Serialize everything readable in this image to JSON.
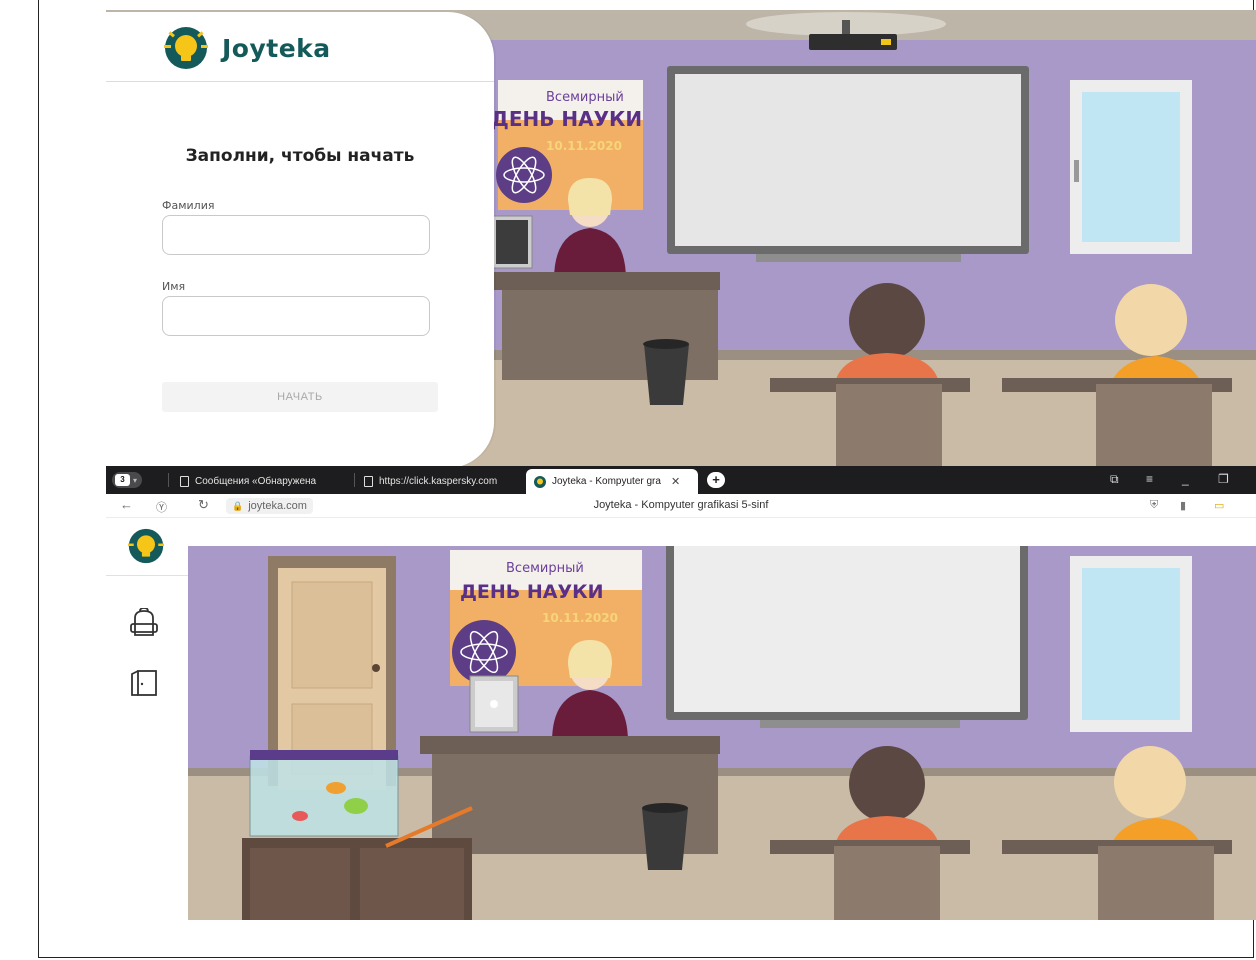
{
  "login": {
    "brand_name": "Joyteka",
    "form_title": "Заполни, чтобы начать",
    "surname_label": "Фамилия",
    "surname_value": "",
    "name_label": "Имя",
    "name_value": "",
    "start_button": "НАЧАТЬ"
  },
  "browser": {
    "tab_count": "3",
    "tabs": [
      {
        "label": "Сообщения «Обнаружена"
      },
      {
        "label": "https://click.kaspersky.com"
      },
      {
        "label": "Joyteka - Kompyuter gra"
      }
    ],
    "address": "joyteka.com",
    "page_title": "Joyteka - Kompyuter grafikasi 5-sinf"
  },
  "scene": {
    "poster_line1": "Всемирный",
    "poster_line2": "ДЕНЬ НАУКИ",
    "poster_date": "10.11.2020"
  },
  "colors": {
    "brand": "#155a5a",
    "brand_bulb": "#f5c518",
    "wall": "#a899c9",
    "floor": "#c9bba6"
  }
}
